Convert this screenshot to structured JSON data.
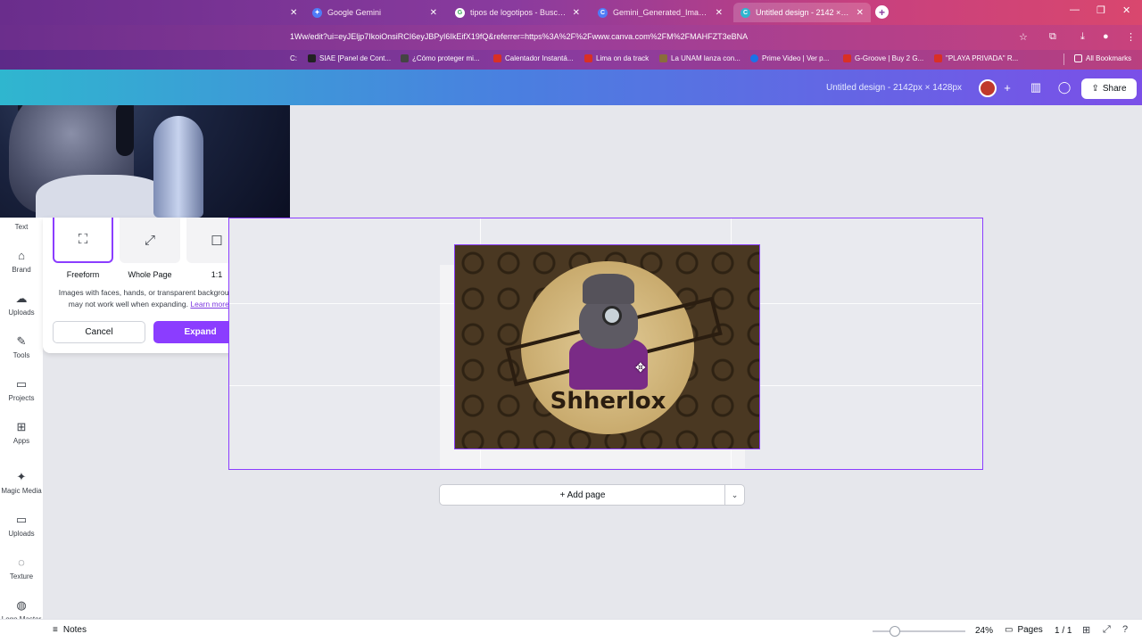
{
  "browser": {
    "tabs": [
      {
        "label": "Google Gemini",
        "color": "#4f7cf7"
      },
      {
        "label": "tipos de logotipos - Buscar con",
        "color": "#34a853"
      },
      {
        "label": "Gemini_Generated_Image_o7",
        "color": "#4f7cf7"
      },
      {
        "label": "Untitled design - 2142 × 1428p",
        "color": "#2fb6cf",
        "active": true
      }
    ],
    "url": "1Ww/edit?ui=eyJEljp7IkoiOnsiRCI6eyJBPyI6IkEifX19fQ&referrer=https%3A%2F%2Fwww.canva.com%2FM%2FMAHFZT3eBNA",
    "bookmarks": [
      {
        "label": "SIAE [Panel de Cont...",
        "color": "#222222"
      },
      {
        "label": "¿Cómo proteger mi...",
        "color": "#444444"
      },
      {
        "label": "Calentador Instantá...",
        "color": "#d93025"
      },
      {
        "label": "Lima on da track",
        "color": "#d93025"
      },
      {
        "label": "La UNAM lanza con...",
        "color": "#8a6d3b"
      },
      {
        "label": "Prime Video | Ver p...",
        "color": "#1a73e8"
      },
      {
        "label": "G-Groove | Buy 2 G...",
        "color": "#d93025"
      },
      {
        "label": "\"PLAYA PRIVADA\" R...",
        "color": "#d93025"
      }
    ],
    "all_bookmarks": "All Bookmarks"
  },
  "header": {
    "design_title": "Untitled design - 2142px × 1428px",
    "share_label": "Share"
  },
  "sidebar": {
    "items": [
      {
        "label": "Text",
        "icon": "T"
      },
      {
        "label": "Brand",
        "icon": "⌂"
      },
      {
        "label": "Uploads",
        "icon": "☁"
      },
      {
        "label": "Tools",
        "icon": "✎"
      },
      {
        "label": "Projects",
        "icon": "▭"
      },
      {
        "label": "Apps",
        "icon": "⊞"
      },
      {
        "label": "Magic Media",
        "icon": "✦"
      },
      {
        "label": "Uploads",
        "icon": "▭"
      },
      {
        "label": "Texture",
        "icon": "◌"
      },
      {
        "label": "Logo Master",
        "icon": "◍"
      }
    ]
  },
  "expand_panel": {
    "options": [
      {
        "label": "Freeform",
        "icon": "⛶",
        "selected": true
      },
      {
        "label": "Whole Page",
        "icon": "⤢",
        "selected": false
      },
      {
        "label": "1:1",
        "icon": "☐",
        "selected": false
      }
    ],
    "note": "Images with faces, hands, or transparent backgrounds may not work well when expanding.",
    "learn_more": "Learn more.",
    "cancel_label": "Cancel",
    "expand_label": "Expand"
  },
  "canvas": {
    "brand_text": "Shherlox",
    "add_page_label": "+ Add page"
  },
  "footer": {
    "notes_label": "Notes",
    "zoom": "24%",
    "zoom_level": 0.24,
    "pages_label": "Pages",
    "page_count": "1 / 1"
  },
  "colors": {
    "accent": "#8b3dff",
    "canvas_bg": "#e6e7ec"
  }
}
